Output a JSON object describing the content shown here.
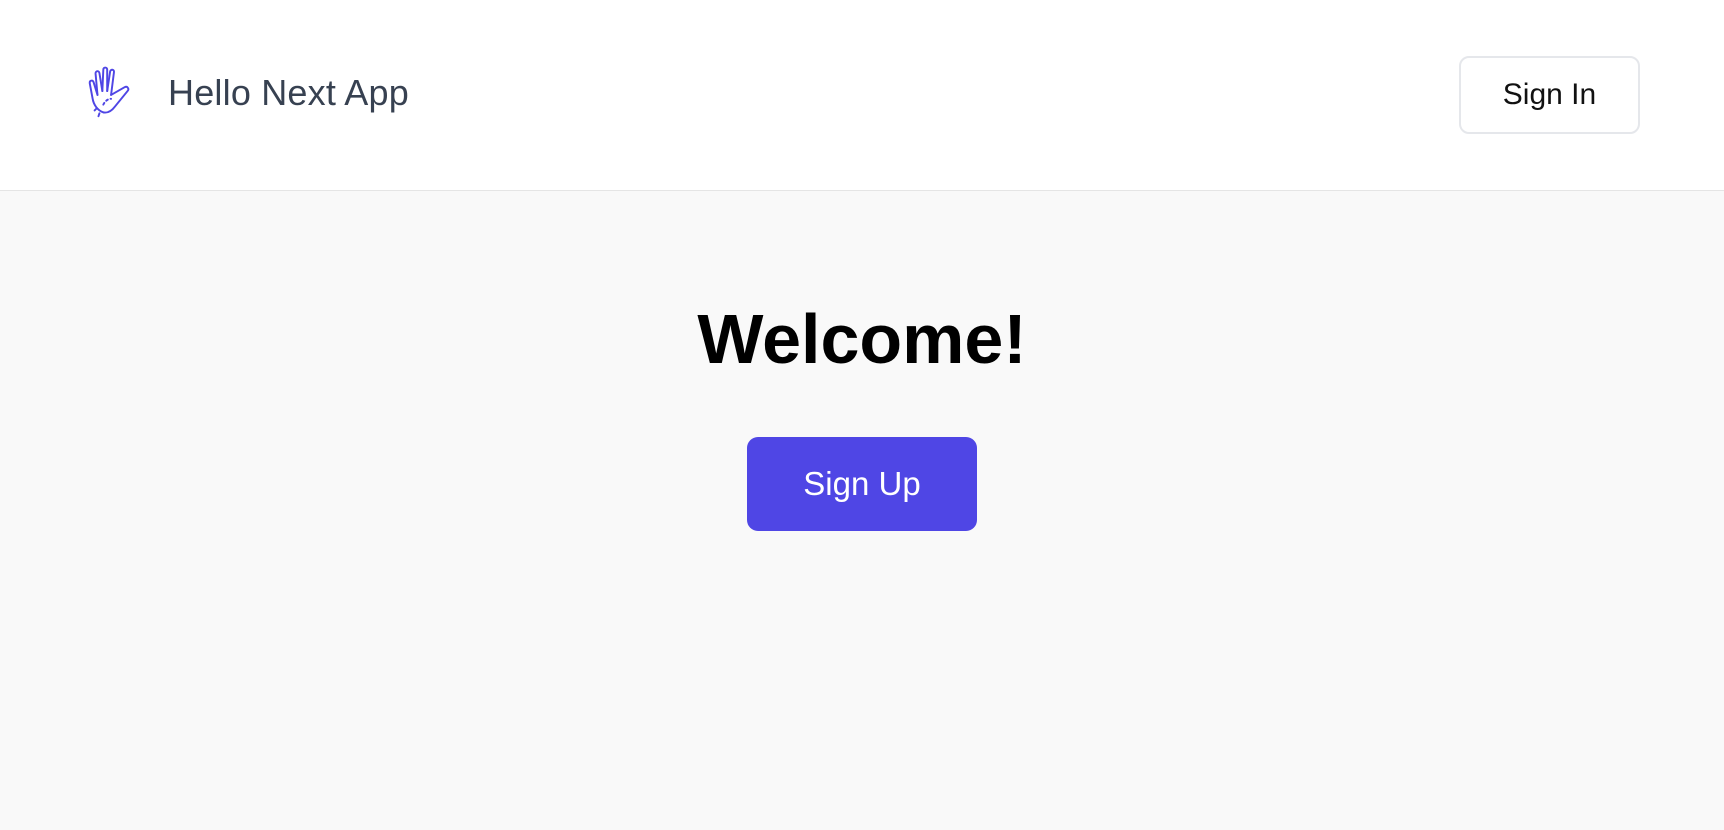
{
  "header": {
    "logo_icon": "waving-hand-icon",
    "app_name": "Hello Next App",
    "sign_in_label": "Sign In"
  },
  "main": {
    "heading": "Welcome!",
    "sign_up_label": "Sign Up"
  },
  "colors": {
    "accent": "#4f46e5",
    "header_background": "#ffffff",
    "page_background": "#f9f9f9",
    "brand_text": "#374151",
    "border": "#e5e7eb"
  }
}
